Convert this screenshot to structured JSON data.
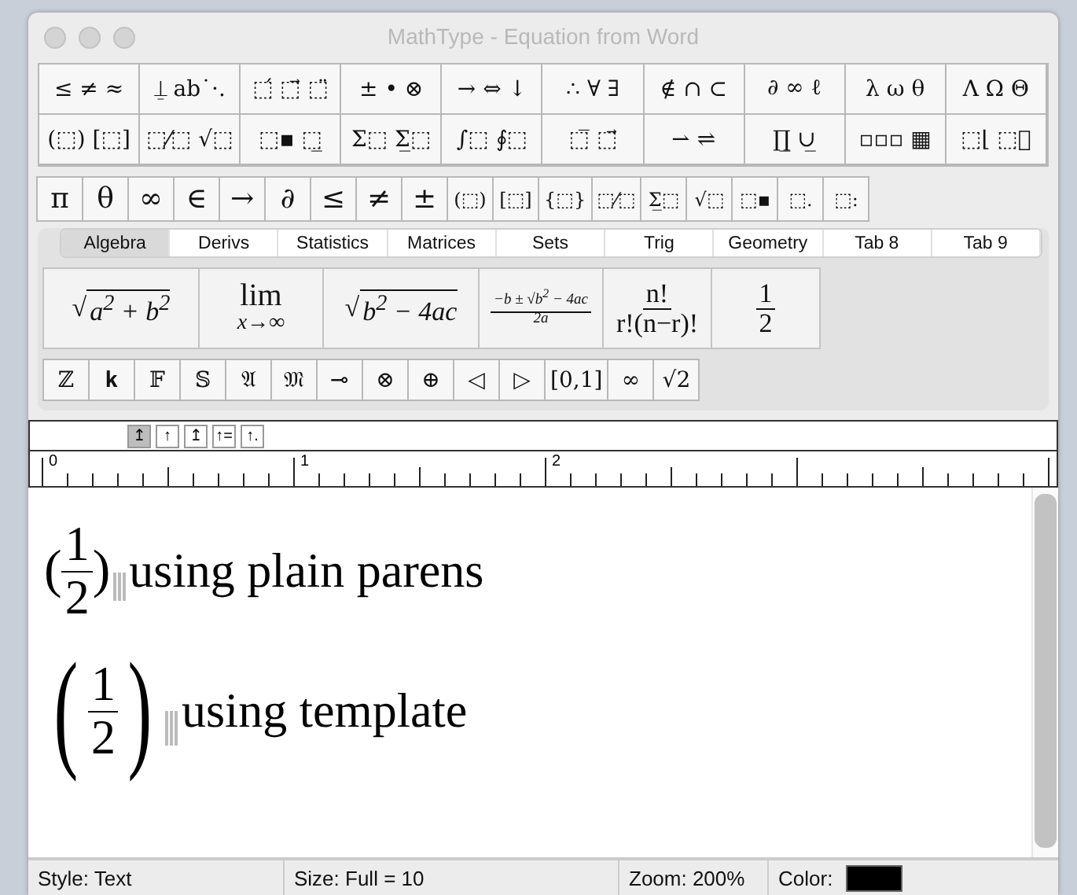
{
  "window": {
    "title": "MathType - Equation from Word"
  },
  "symbol_rows": [
    [
      "≤ ≠ ≈",
      "⍊ ab˙·.",
      "⬚́ ⬚⃗ ⬚̈",
      "± • ⊗",
      "→ ⇔ ↓",
      "∴ ∀ ∃",
      "∉ ∩ ⊂",
      "∂ ∞ ℓ",
      "λ ω θ",
      "Λ Ω Θ"
    ],
    [
      "(⬚) [⬚]",
      "⬚⁄⬚ √⬚",
      "⬚▪ ⬚̲",
      "Σ⬚ Σ̲⬚",
      "∫⬚ ∮⬚",
      "⬚̅ ⬚⃗",
      "⇀ ⇌",
      "∏̲ ∪̲",
      "▫▫▫ ▦",
      "⬚⌊ ⬚⃞"
    ]
  ],
  "small_bar": [
    "π",
    "θ",
    "∞",
    "∈",
    "→",
    "∂",
    "≤",
    "≠",
    "±",
    "(⬚)",
    "[⬚]",
    "{⬚}",
    "⬚⁄⬚",
    "Σ̲⬚",
    "√⬚",
    "⬚▪",
    "⬚.",
    "⬚:"
  ],
  "tabs": [
    {
      "label": "Algebra",
      "selected": true
    },
    {
      "label": "Derivs",
      "selected": false
    },
    {
      "label": "Statistics",
      "selected": false
    },
    {
      "label": "Matrices",
      "selected": false
    },
    {
      "label": "Sets",
      "selected": false
    },
    {
      "label": "Trig",
      "selected": false
    },
    {
      "label": "Geometry",
      "selected": false
    },
    {
      "label": "Tab 8",
      "selected": false
    },
    {
      "label": "Tab 9",
      "selected": false
    }
  ],
  "templates": [
    {
      "kind": "sqrt",
      "radical": "√",
      "body": "a$^{2}$ + b$^{2}$"
    },
    {
      "kind": "lim",
      "top": "lim",
      "bottom": "x→∞"
    },
    {
      "kind": "sqrt",
      "radical": "√",
      "body": "b$^{2}$ − 4ac"
    },
    {
      "kind": "small_frac",
      "num": "−b ± √b$^{2}$ − 4ac",
      "den": "2a"
    },
    {
      "kind": "frac",
      "num": "n!",
      "den": "r!(n−r)!"
    },
    {
      "kind": "frac",
      "num": "1",
      "den": "2"
    }
  ],
  "font_bar": [
    "ℤ",
    "𝐤",
    "𝔽",
    "𝕊",
    "𝔄",
    "𝔐",
    "⊸",
    "⊗",
    "⊕",
    "◁",
    "▷",
    "[0,1]",
    "∞",
    "√2"
  ],
  "nudge_buttons": [
    {
      "label": "↥",
      "selected": true
    },
    {
      "label": "↑",
      "selected": false
    },
    {
      "label": "↥",
      "selected": false
    },
    {
      "label": "↑=",
      "selected": false
    },
    {
      "label": "↑.",
      "selected": false
    }
  ],
  "ruler": {
    "labels": [
      "0",
      "1",
      "2"
    ]
  },
  "document": [
    {
      "kind": "plain",
      "open": "(",
      "num": "1",
      "den": "2",
      "close": ")",
      "text": "using plain parens"
    },
    {
      "kind": "template",
      "open": "(",
      "num": "1",
      "den": "2",
      "close": ")",
      "text": "using template"
    }
  ],
  "status_bar": {
    "style": "Style: Text",
    "size": "Size: Full = 10",
    "zoom": "Zoom: 200%",
    "color_label": "Color:",
    "color": "#000000"
  }
}
